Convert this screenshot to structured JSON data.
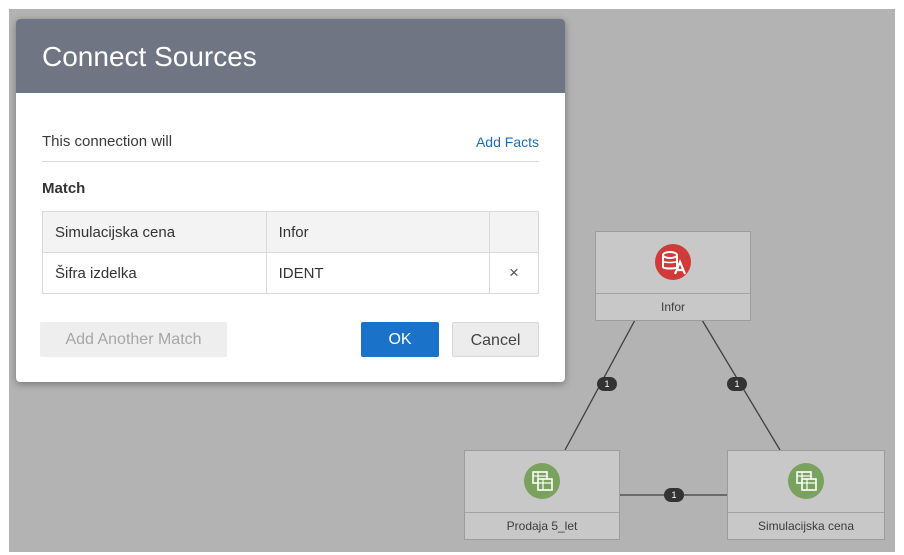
{
  "dialog": {
    "title": "Connect Sources",
    "connection_text": "This connection will",
    "add_facts_link": "Add Facts",
    "match_title": "Match",
    "table": {
      "headers": [
        "Simulacijska cena",
        "Infor",
        ""
      ],
      "rows": [
        {
          "left": "Šifra izdelka",
          "right": "IDENT",
          "remove": "×"
        }
      ]
    },
    "add_another_match": "Add Another Match",
    "ok": "OK",
    "cancel": "Cancel"
  },
  "diagram": {
    "nodes": [
      {
        "id": "infor",
        "label": "Infor",
        "icon": "database-analytics-icon",
        "color": "#d03a38"
      },
      {
        "id": "prodaja",
        "label": "Prodaja 5_let",
        "icon": "dataset-icon",
        "color": "#78a25e"
      },
      {
        "id": "simulacijska",
        "label": "Simulacijska cena",
        "icon": "dataset-icon",
        "color": "#78a25e"
      }
    ],
    "links": [
      {
        "from": "infor",
        "to": "prodaja",
        "count": "1"
      },
      {
        "from": "infor",
        "to": "simulacijska",
        "count": "1"
      },
      {
        "from": "prodaja",
        "to": "simulacijska",
        "count": "1"
      }
    ]
  }
}
